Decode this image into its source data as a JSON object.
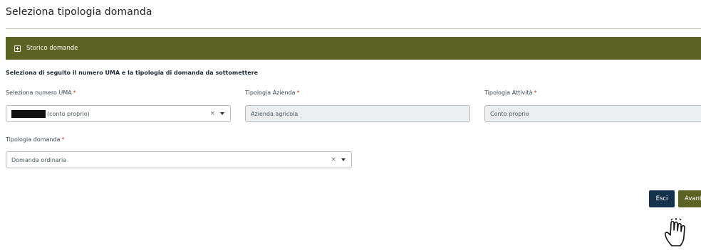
{
  "page": {
    "title": "Seleziona tipologia domanda"
  },
  "accordion": {
    "label": "Storico domande",
    "icon": "expand-plus-icon"
  },
  "instruction": "Seleziona di seguito il numero UMA e la tipologia di domanda da sottomettere",
  "required_marker": "*",
  "fields": {
    "numero_uma": {
      "label": "Seleziona numero UMA",
      "value_suffix": "(conto proprio)",
      "clear_icon": "×"
    },
    "tipologia_azienda": {
      "label": "Tipologia Azienda",
      "value": "Azienda agricola"
    },
    "tipologia_attivita": {
      "label": "Tipologia Attività",
      "value": "Conto proprio"
    },
    "tipologia_domanda": {
      "label": "Tipologia domanda",
      "value": "Domanda ordinaria",
      "clear_icon": "×"
    }
  },
  "buttons": {
    "exit": "Esci",
    "next": "Avanti"
  },
  "colors": {
    "accent_olive": "#5a6224",
    "navy": "#15324c",
    "required": "#c0392b"
  }
}
